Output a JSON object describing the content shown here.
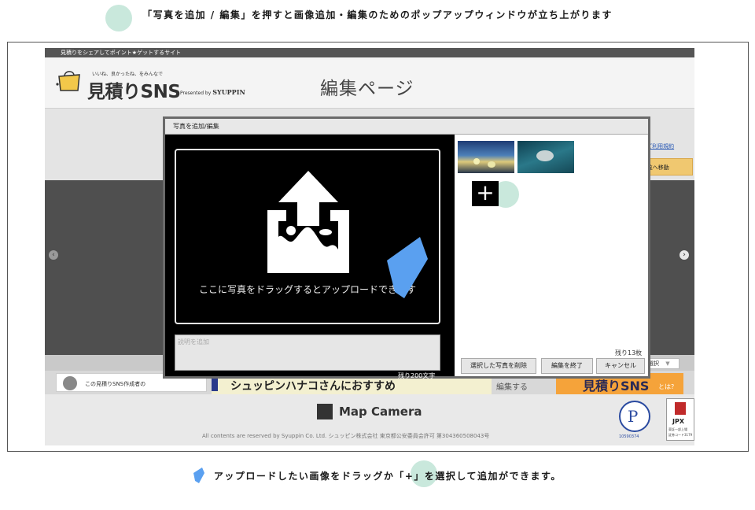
{
  "captions": {
    "top": "「写真を追加 / 編集」を押すと画像追加・編集のためのポップアップウィンドウが立ち上がります",
    "bottom": "アップロードしたい画像をドラッグか「+」を選択して追加ができます。"
  },
  "site": {
    "topbar_text": "見積りをシェアしてポイント★ゲットするサイト",
    "logo_tagline": "いいね、良かったね、をみんなで",
    "logo_name": "見積りSNS",
    "logo_presented": "Presented by",
    "logo_company": "SYUPPIN",
    "page_heading": "編集ページ",
    "terms_link": "見積りSNSご利用規約",
    "save_button": "保存して一覧へ移動",
    "creator_card": "この見積りSNS作成者の",
    "recommend_banner": "シュッピンハナコさんにおすすめ",
    "edit_link": "編集する",
    "language_select": "言語を選択",
    "language_caret": "▼",
    "sns_banner": "見積りSNS",
    "sns_banner_suffix": "とは?",
    "footer_brand": "Map Camera",
    "footer_copyright": "All contents are reserved by Syuppin Co. Ltd. シュッピン株式会社 東京都公安委員会許可 第304360508043号",
    "privacy_number": "10590374",
    "jpx_label": "JPX",
    "jpx_sub1": "東証一部上場",
    "jpx_sub2": "証券コード3179",
    "arrow_left": "‹",
    "arrow_right": "›"
  },
  "modal": {
    "title": "写真を追加/編集",
    "drop_text": "ここに写真をドラッグするとアップロードできます",
    "description_placeholder": "説明を追加",
    "char_remaining": "残り200文字",
    "photos_remaining": "残り13枚",
    "plus_label": "+",
    "buttons": {
      "delete_selected": "選択した写真を削除",
      "finish_edit": "編集を終了",
      "cancel": "キャンセル"
    }
  },
  "colors": {
    "highlight_circle": "#c9e8dc",
    "cursor_blue": "#5aa0f0",
    "save_button": "#f0c870"
  }
}
